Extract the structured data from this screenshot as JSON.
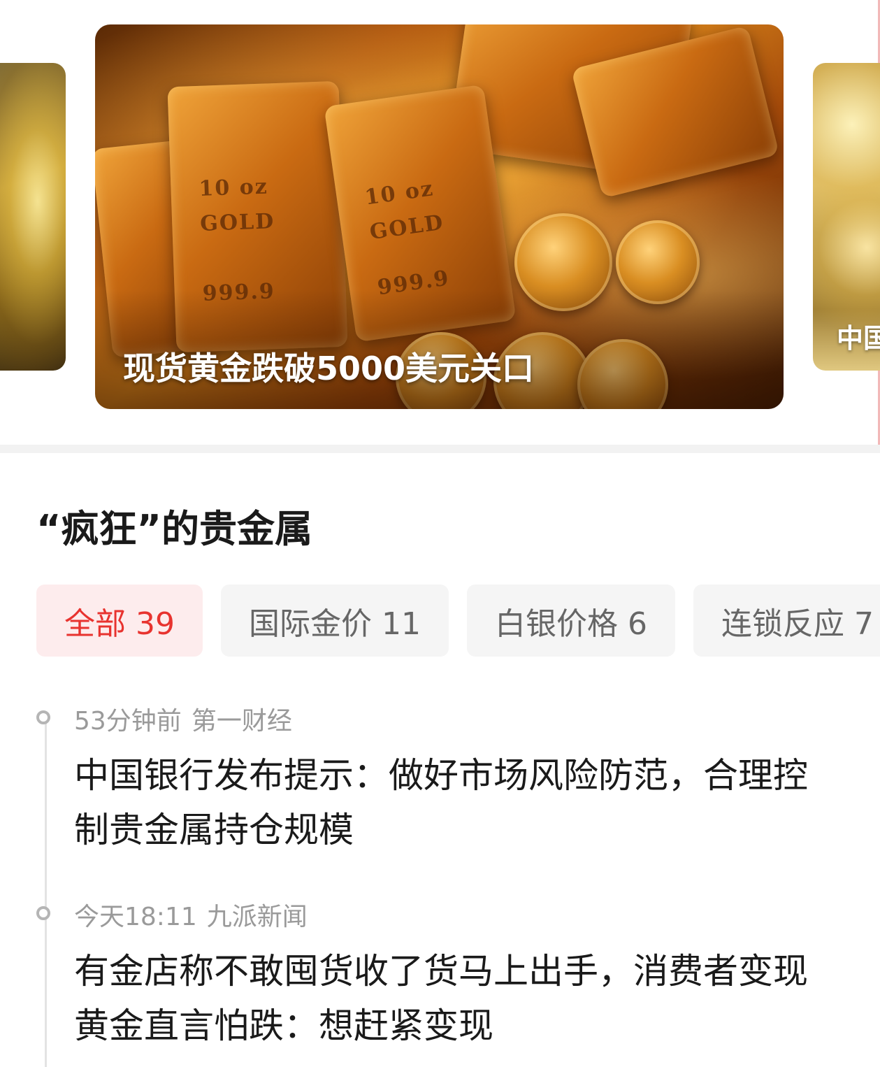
{
  "carousel": {
    "left_slide_title": "",
    "main_slide_title": "现货黄金跌破5000美元关口",
    "right_slide_title": "中国",
    "main_image_icon": "gold-bars-photo",
    "main_bar_stamps": [
      "10 oz",
      "GOLD",
      "999.9"
    ]
  },
  "section": {
    "title": "“疯狂”的贵金属"
  },
  "tabs": [
    {
      "label": "全部 39",
      "active": true
    },
    {
      "label": "国际金价 11",
      "active": false
    },
    {
      "label": "白银价格 6",
      "active": false
    },
    {
      "label": "连锁反应 7",
      "active": false
    }
  ],
  "news": [
    {
      "time": "53分钟前",
      "source": "第一财经",
      "headline": "中国银行发布提示：做好市场风险防范，合理控制贵金属持仓规模"
    },
    {
      "time": "今天18:11",
      "source": "九派新闻",
      "headline": "有金店称不敢囤货收了货马上出手，消费者变现黄金直言怕跌：想赶紧变现"
    }
  ],
  "colors": {
    "accent": "#e8332f",
    "active_tab_bg": "#fdeced",
    "tab_bg": "#f5f5f5",
    "meta_text": "#9a9a9a"
  }
}
